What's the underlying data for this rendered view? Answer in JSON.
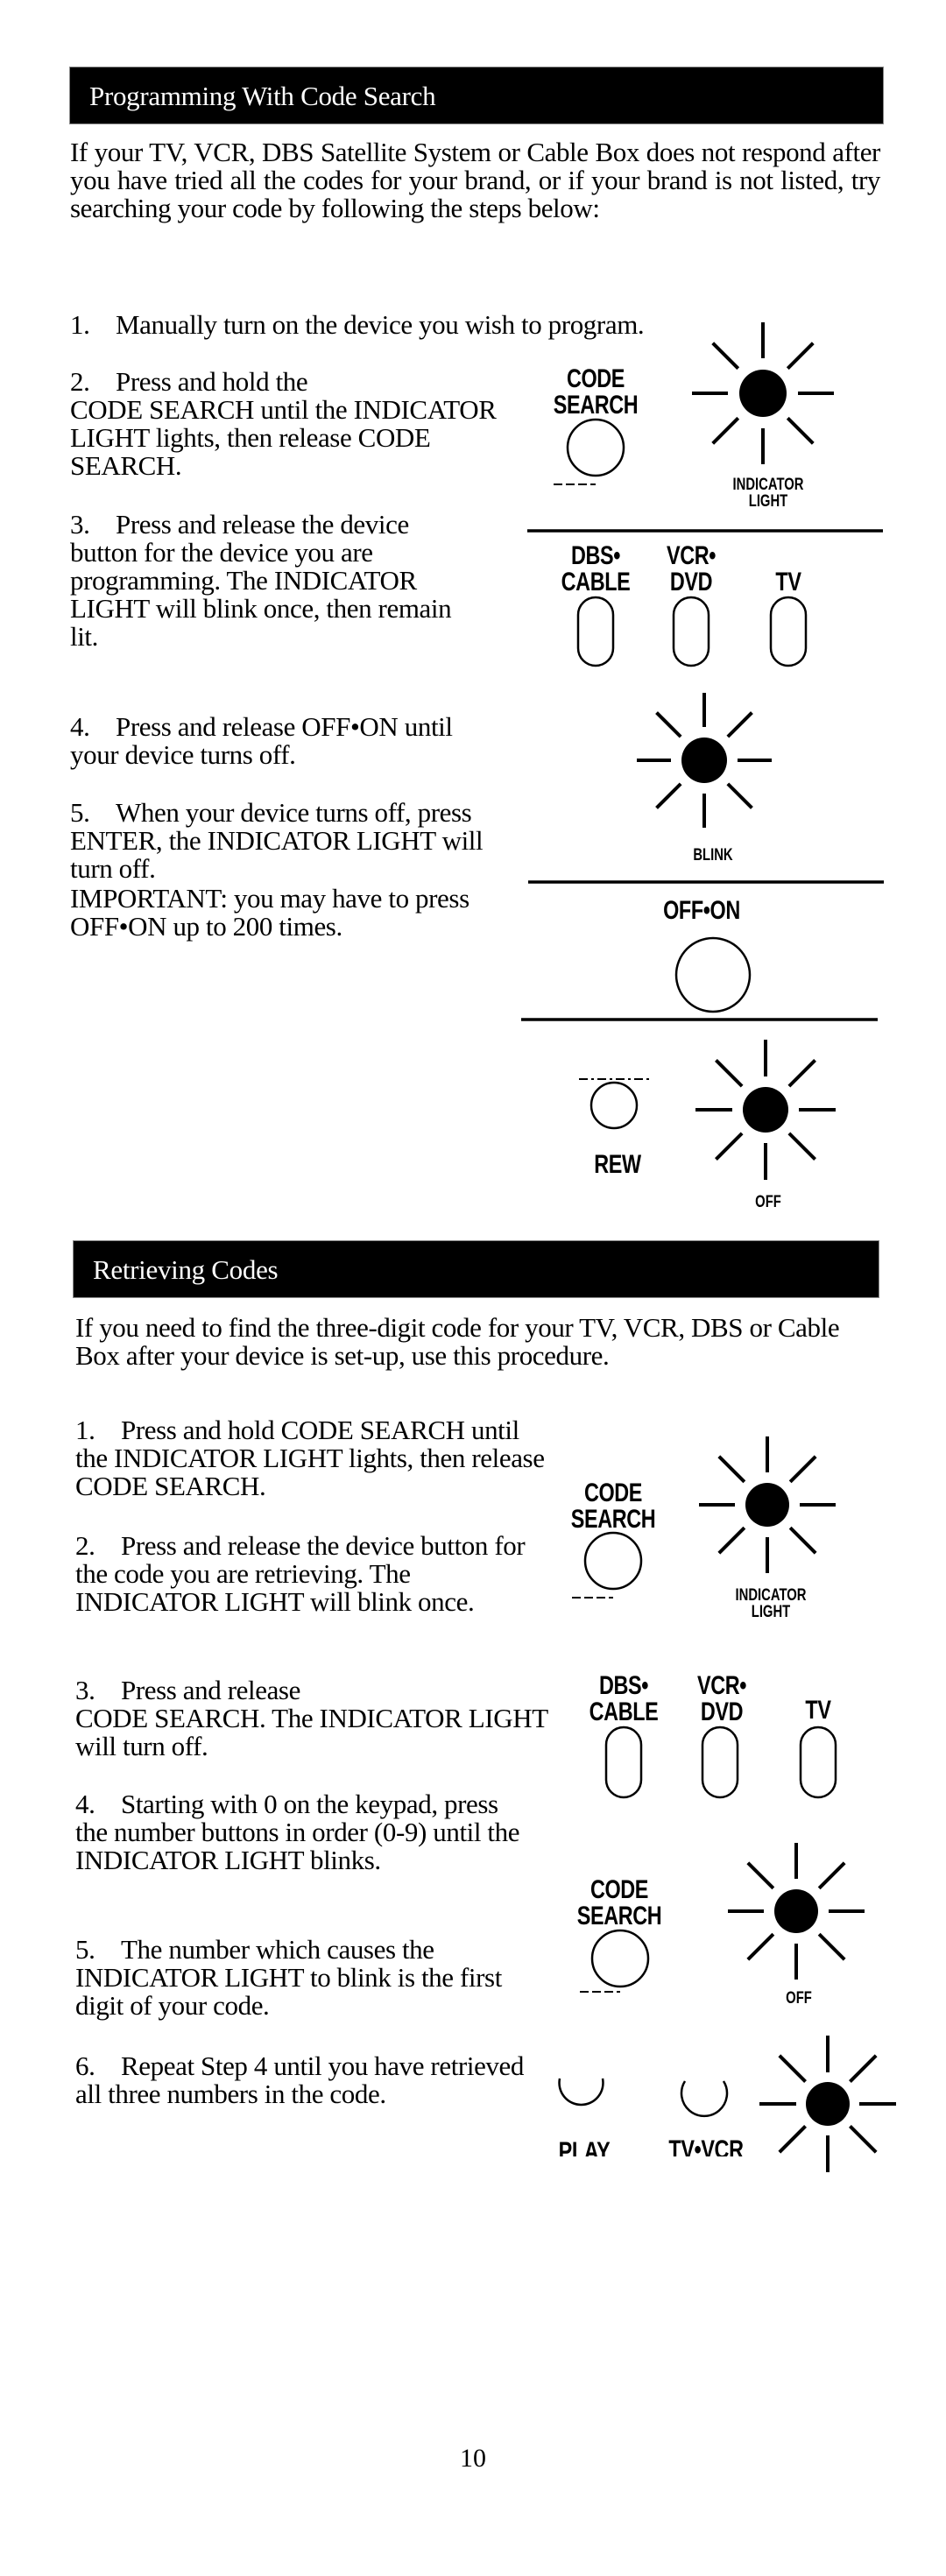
{
  "sections": [
    {
      "title": "Programming With Code Search",
      "intro": "If your TV, VCR, DBS Satellite System or Cable Box  does not respond after you have tried all the codes for your brand, or if your brand is not listed, try searching your code by following the steps below:",
      "steps": [
        {
          "num": "1.",
          "text": "Manually turn on the device you wish to program."
        },
        {
          "num": "2.",
          "text": "Press and hold the\nCODE SEARCH until the INDICATOR LIGHT lights, then release CODE SEARCH."
        },
        {
          "num": "3.",
          "text": "Press and release the device button for the device you are programming. The INDICATOR LIGHT will blink once, then remain lit."
        },
        {
          "num": "4.",
          "text": "Press and release OFF•ON until your device turns off."
        },
        {
          "num": "5.",
          "text": "When your device turns off, press ENTER, the INDICATOR LIGHT will turn off."
        }
      ],
      "note": "IMPORTANT: you may have to press OFF•ON up to 200 times.",
      "illustrations": {
        "code_search_label": "CODE\nSEARCH",
        "indicator_label": "INDICATOR\nLIGHT",
        "device_buttons": [
          {
            "label": "DBS•\nCABLE"
          },
          {
            "label": "VCR•\nDVD"
          },
          {
            "label": "TV"
          }
        ],
        "blink_label": "BLINK",
        "off_on_label": "OFF•ON",
        "rew_label": "REW",
        "off_label": "OFF"
      }
    },
    {
      "title": "Retrieving Codes",
      "intro": "If you need to find the three-digit code for your TV, VCR, DBS or Cable Box after your device is set-up, use this procedure.",
      "steps": [
        {
          "num": "1.",
          "text": "Press and hold CODE SEARCH until the INDICATOR LIGHT lights, then release CODE SEARCH."
        },
        {
          "num": "2.",
          "text": "Press and release the device button for the code you are retrieving. The INDICATOR LIGHT will blink once."
        },
        {
          "num": "3.",
          "text": "Press and release\nCODE SEARCH. The INDICATOR LIGHT will turn off."
        },
        {
          "num": "4.",
          "text": "Starting with 0 on the keypad, press the number buttons in order (0-9) until the INDICATOR LIGHT blinks."
        },
        {
          "num": "5.",
          "text": "The number which causes the INDICATOR LIGHT to blink is the first digit of your code."
        },
        {
          "num": "6.",
          "text": "Repeat Step 4 until you have retrieved all three numbers in the code."
        }
      ],
      "illustrations": {
        "code_search_label": "CODE\nSEARCH",
        "indicator_label": "INDICATOR\nLIGHT",
        "device_buttons": [
          {
            "label": "DBS•\nCABLE"
          },
          {
            "label": "VCR•\nDVD"
          },
          {
            "label": "TV"
          }
        ],
        "code_search_label_2": "CODE\nSEARCH",
        "off_label": "OFF",
        "play_label": "PLAY",
        "tv_vcr_label": "TV•VCR"
      }
    }
  ],
  "page_number": "10"
}
